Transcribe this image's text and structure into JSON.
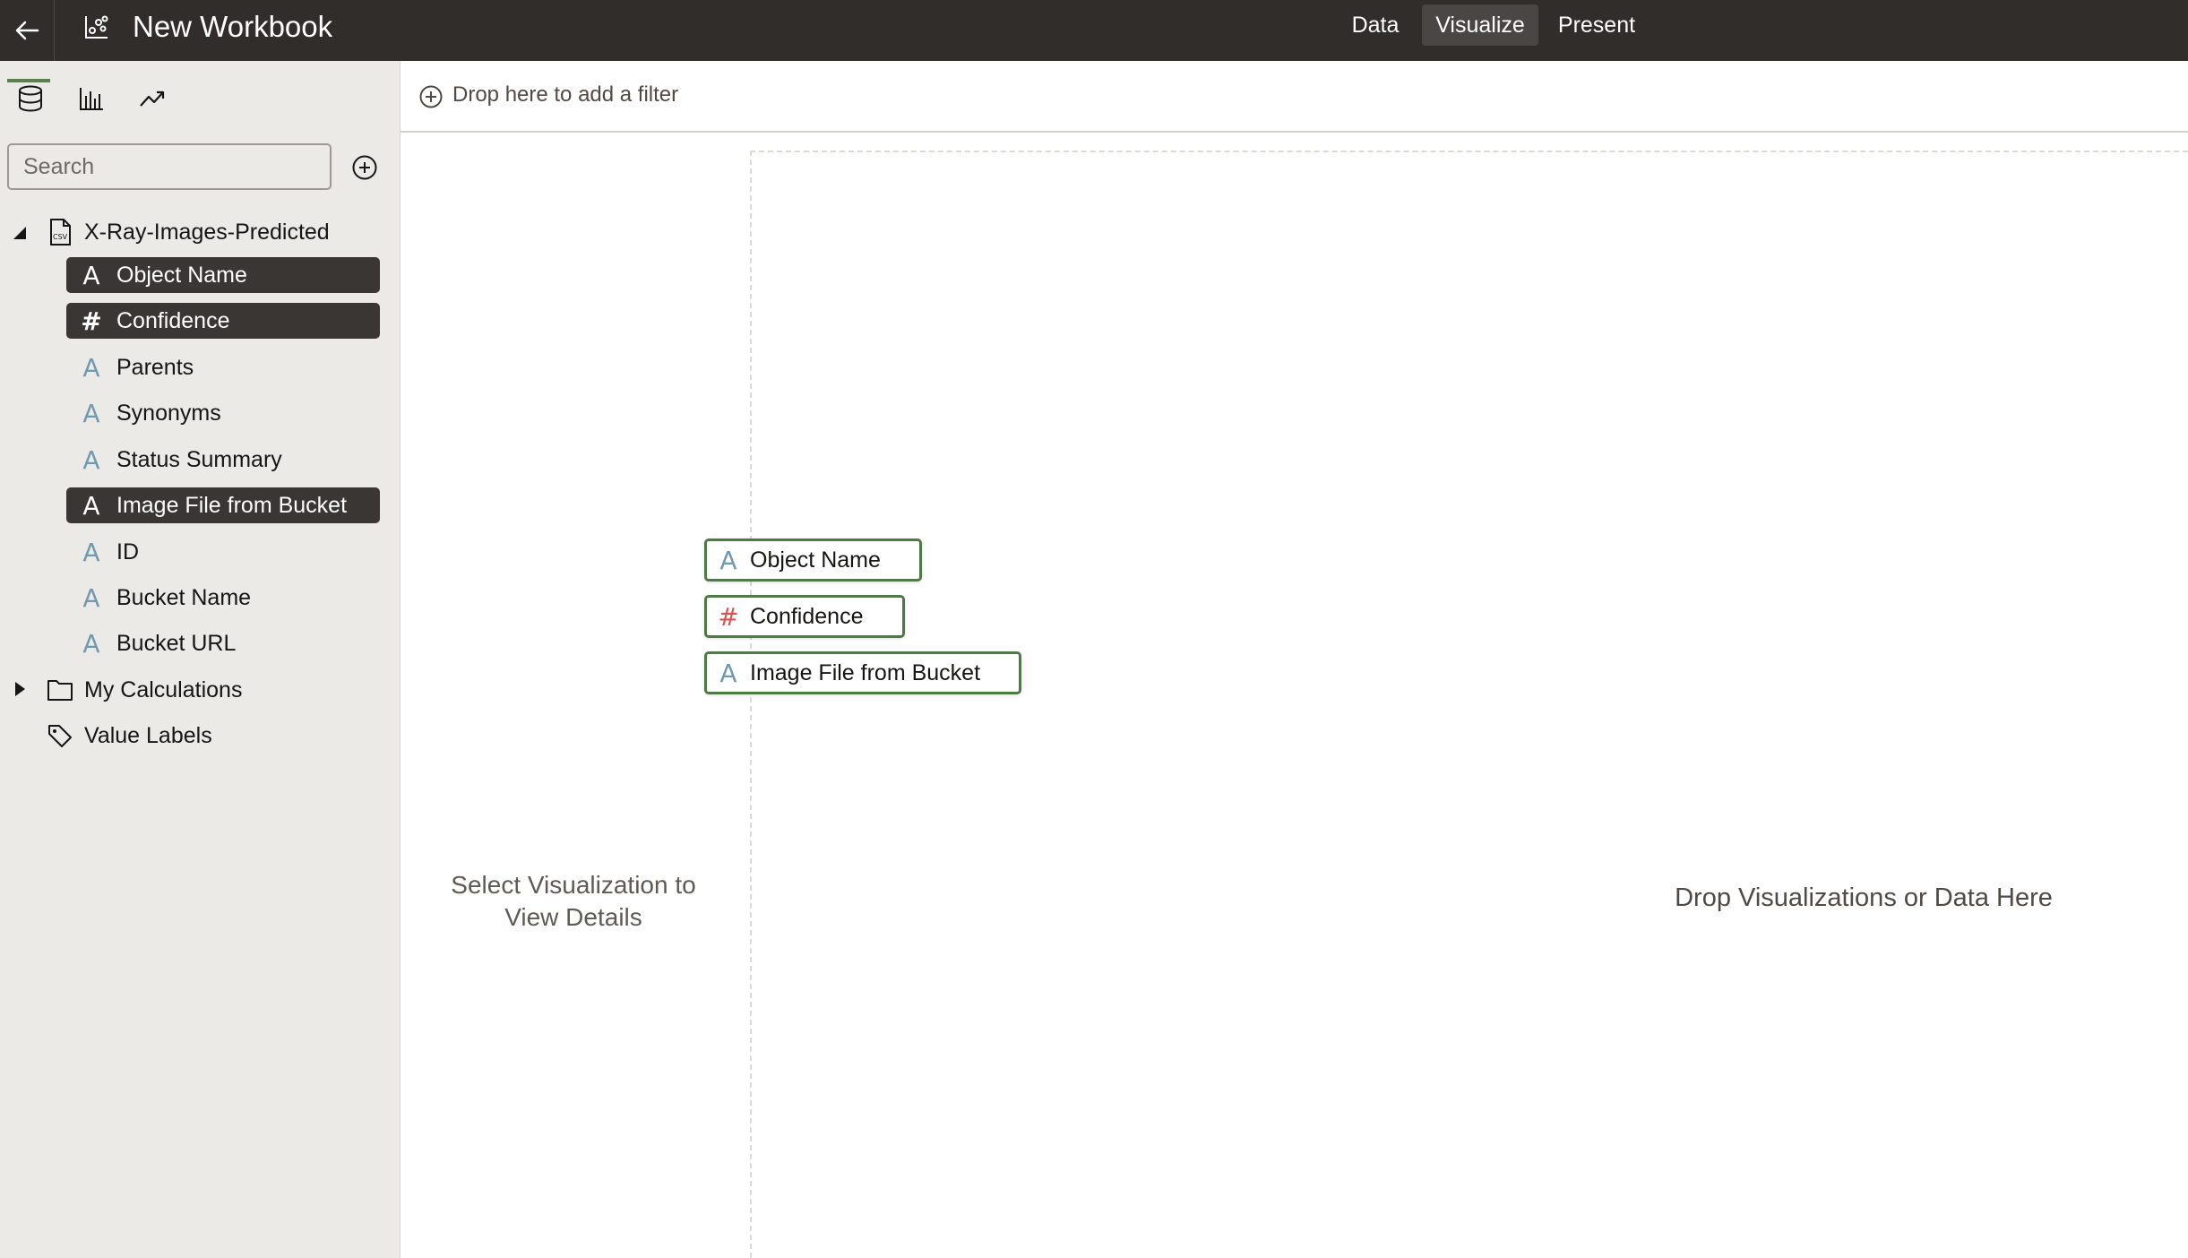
{
  "app": {
    "title": "New Workbook",
    "modes": [
      "Data",
      "Visualize",
      "Present"
    ],
    "active_mode": "Visualize"
  },
  "left_panel": {
    "search": {
      "placeholder": "Search",
      "value": ""
    },
    "dataset": {
      "name": "X-Ray-Images-Predicted",
      "fields": [
        {
          "label": "Object Name",
          "kind": "attribute",
          "symbol": "A",
          "selected": true
        },
        {
          "label": "Confidence",
          "kind": "measure",
          "symbol": "#",
          "selected": true
        },
        {
          "label": "Parents",
          "kind": "attribute",
          "symbol": "A",
          "selected": false
        },
        {
          "label": "Synonyms",
          "kind": "attribute",
          "symbol": "A",
          "selected": false
        },
        {
          "label": "Status Summary",
          "kind": "attribute",
          "symbol": "A",
          "selected": false
        },
        {
          "label": "Image File from Bucket",
          "kind": "attribute",
          "symbol": "A",
          "selected": true
        },
        {
          "label": "ID",
          "kind": "attribute",
          "symbol": "A",
          "selected": false
        },
        {
          "label": "Bucket Name",
          "kind": "attribute",
          "symbol": "A",
          "selected": false
        },
        {
          "label": "Bucket URL",
          "kind": "attribute",
          "symbol": "A",
          "selected": false
        }
      ]
    },
    "my_calculations": "My Calculations",
    "value_labels": "Value Labels"
  },
  "filter_bar": {
    "placeholder": "Drop here to add a filter"
  },
  "grammar_panel": {
    "message": "Select Visualization to View Details"
  },
  "canvas": {
    "message": "Drop Visualizations or Data Here"
  },
  "dragged_items": [
    {
      "label": "Object Name",
      "symbol": "A",
      "kind": "attribute"
    },
    {
      "label": "Confidence",
      "symbol": "#",
      "kind": "measure"
    },
    {
      "label": "Image File from Bucket",
      "symbol": "A",
      "kind": "attribute"
    }
  ],
  "colors": {
    "topbar": "#312d2a",
    "panel": "#eceae7",
    "selected_field": "#3a3633",
    "accent_green": "#4d7a45",
    "attribute_icon": "#6f9ab0",
    "measure_icon": "#d9534f"
  }
}
